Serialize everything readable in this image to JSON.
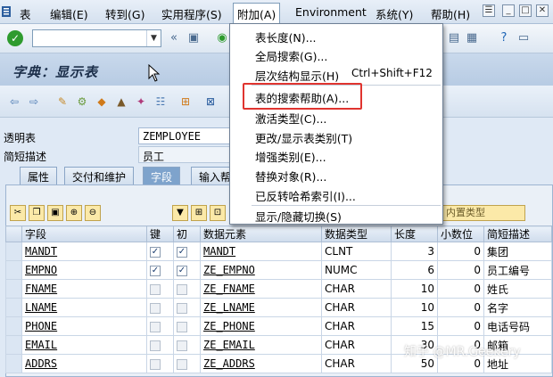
{
  "menubar": {
    "items": [
      "表",
      "编辑(E)",
      "转到(G)",
      "实用程序(S)",
      "附加(A)",
      "Environment",
      "系统(Y)",
      "帮助(H)"
    ]
  },
  "header": {
    "title": "字典：显示表"
  },
  "fields": [
    {
      "label": "透明表",
      "value": "ZEMPLOYEE"
    },
    {
      "label": "简短描述",
      "value": "员工"
    }
  ],
  "tabs": [
    "属性",
    "交付和维护",
    "字段",
    "输入帮"
  ],
  "toolbar2": {
    "promo_label": "内置类型"
  },
  "grid": {
    "headers": [
      "字段",
      "键",
      "初",
      "数据元素",
      "数据类型",
      "长度",
      "小数位",
      "简短描述"
    ],
    "rows": [
      {
        "field": "MANDT",
        "key": true,
        "init": true,
        "element": "MANDT",
        "type": "CLNT",
        "len": "3",
        "dec": "0",
        "desc": "集团"
      },
      {
        "field": "EMPNO",
        "key": true,
        "init": true,
        "element": "ZE_EMPNO",
        "type": "NUMC",
        "len": "6",
        "dec": "0",
        "desc": "员工编号"
      },
      {
        "field": "FNAME",
        "key": false,
        "init": false,
        "element": "ZE_FNAME",
        "type": "CHAR",
        "len": "10",
        "dec": "0",
        "desc": "姓氏"
      },
      {
        "field": "LNAME",
        "key": false,
        "init": false,
        "element": "ZE_LNAME",
        "type": "CHAR",
        "len": "10",
        "dec": "0",
        "desc": "名字"
      },
      {
        "field": "PHONE",
        "key": false,
        "init": false,
        "element": "ZE_PHONE",
        "type": "CHAR",
        "len": "15",
        "dec": "0",
        "desc": "电话号码"
      },
      {
        "field": "EMAIL",
        "key": false,
        "init": false,
        "element": "ZE_EMAIL",
        "type": "CHAR",
        "len": "30",
        "dec": "0",
        "desc": "邮箱"
      },
      {
        "field": "ADDRS",
        "key": false,
        "init": false,
        "element": "ZE_ADDRS",
        "type": "CHAR",
        "len": "50",
        "dec": "0",
        "desc": "地址"
      }
    ]
  },
  "dropdown": {
    "items": [
      {
        "label": "表长度(N)..."
      },
      {
        "label": "全局搜索(G)..."
      },
      {
        "label": "层次结构显示(H)",
        "shortcut": "Ctrl+Shift+F12"
      },
      {
        "label": "表的搜索帮助(A)..."
      },
      {
        "label": "激活类型(C)..."
      },
      {
        "label": "更改/显示表类别(T)"
      },
      {
        "label": "增强类别(E)..."
      },
      {
        "label": "替换对象(R)..."
      },
      {
        "label": "已反转哈希索引(I)..."
      },
      {
        "label": "显示/隐藏切换(S)"
      }
    ]
  },
  "watermark": "知乎 @MR.Geekery",
  "colors": {
    "highlight": "#e0342f",
    "active_tab": "#7ea3cc"
  }
}
